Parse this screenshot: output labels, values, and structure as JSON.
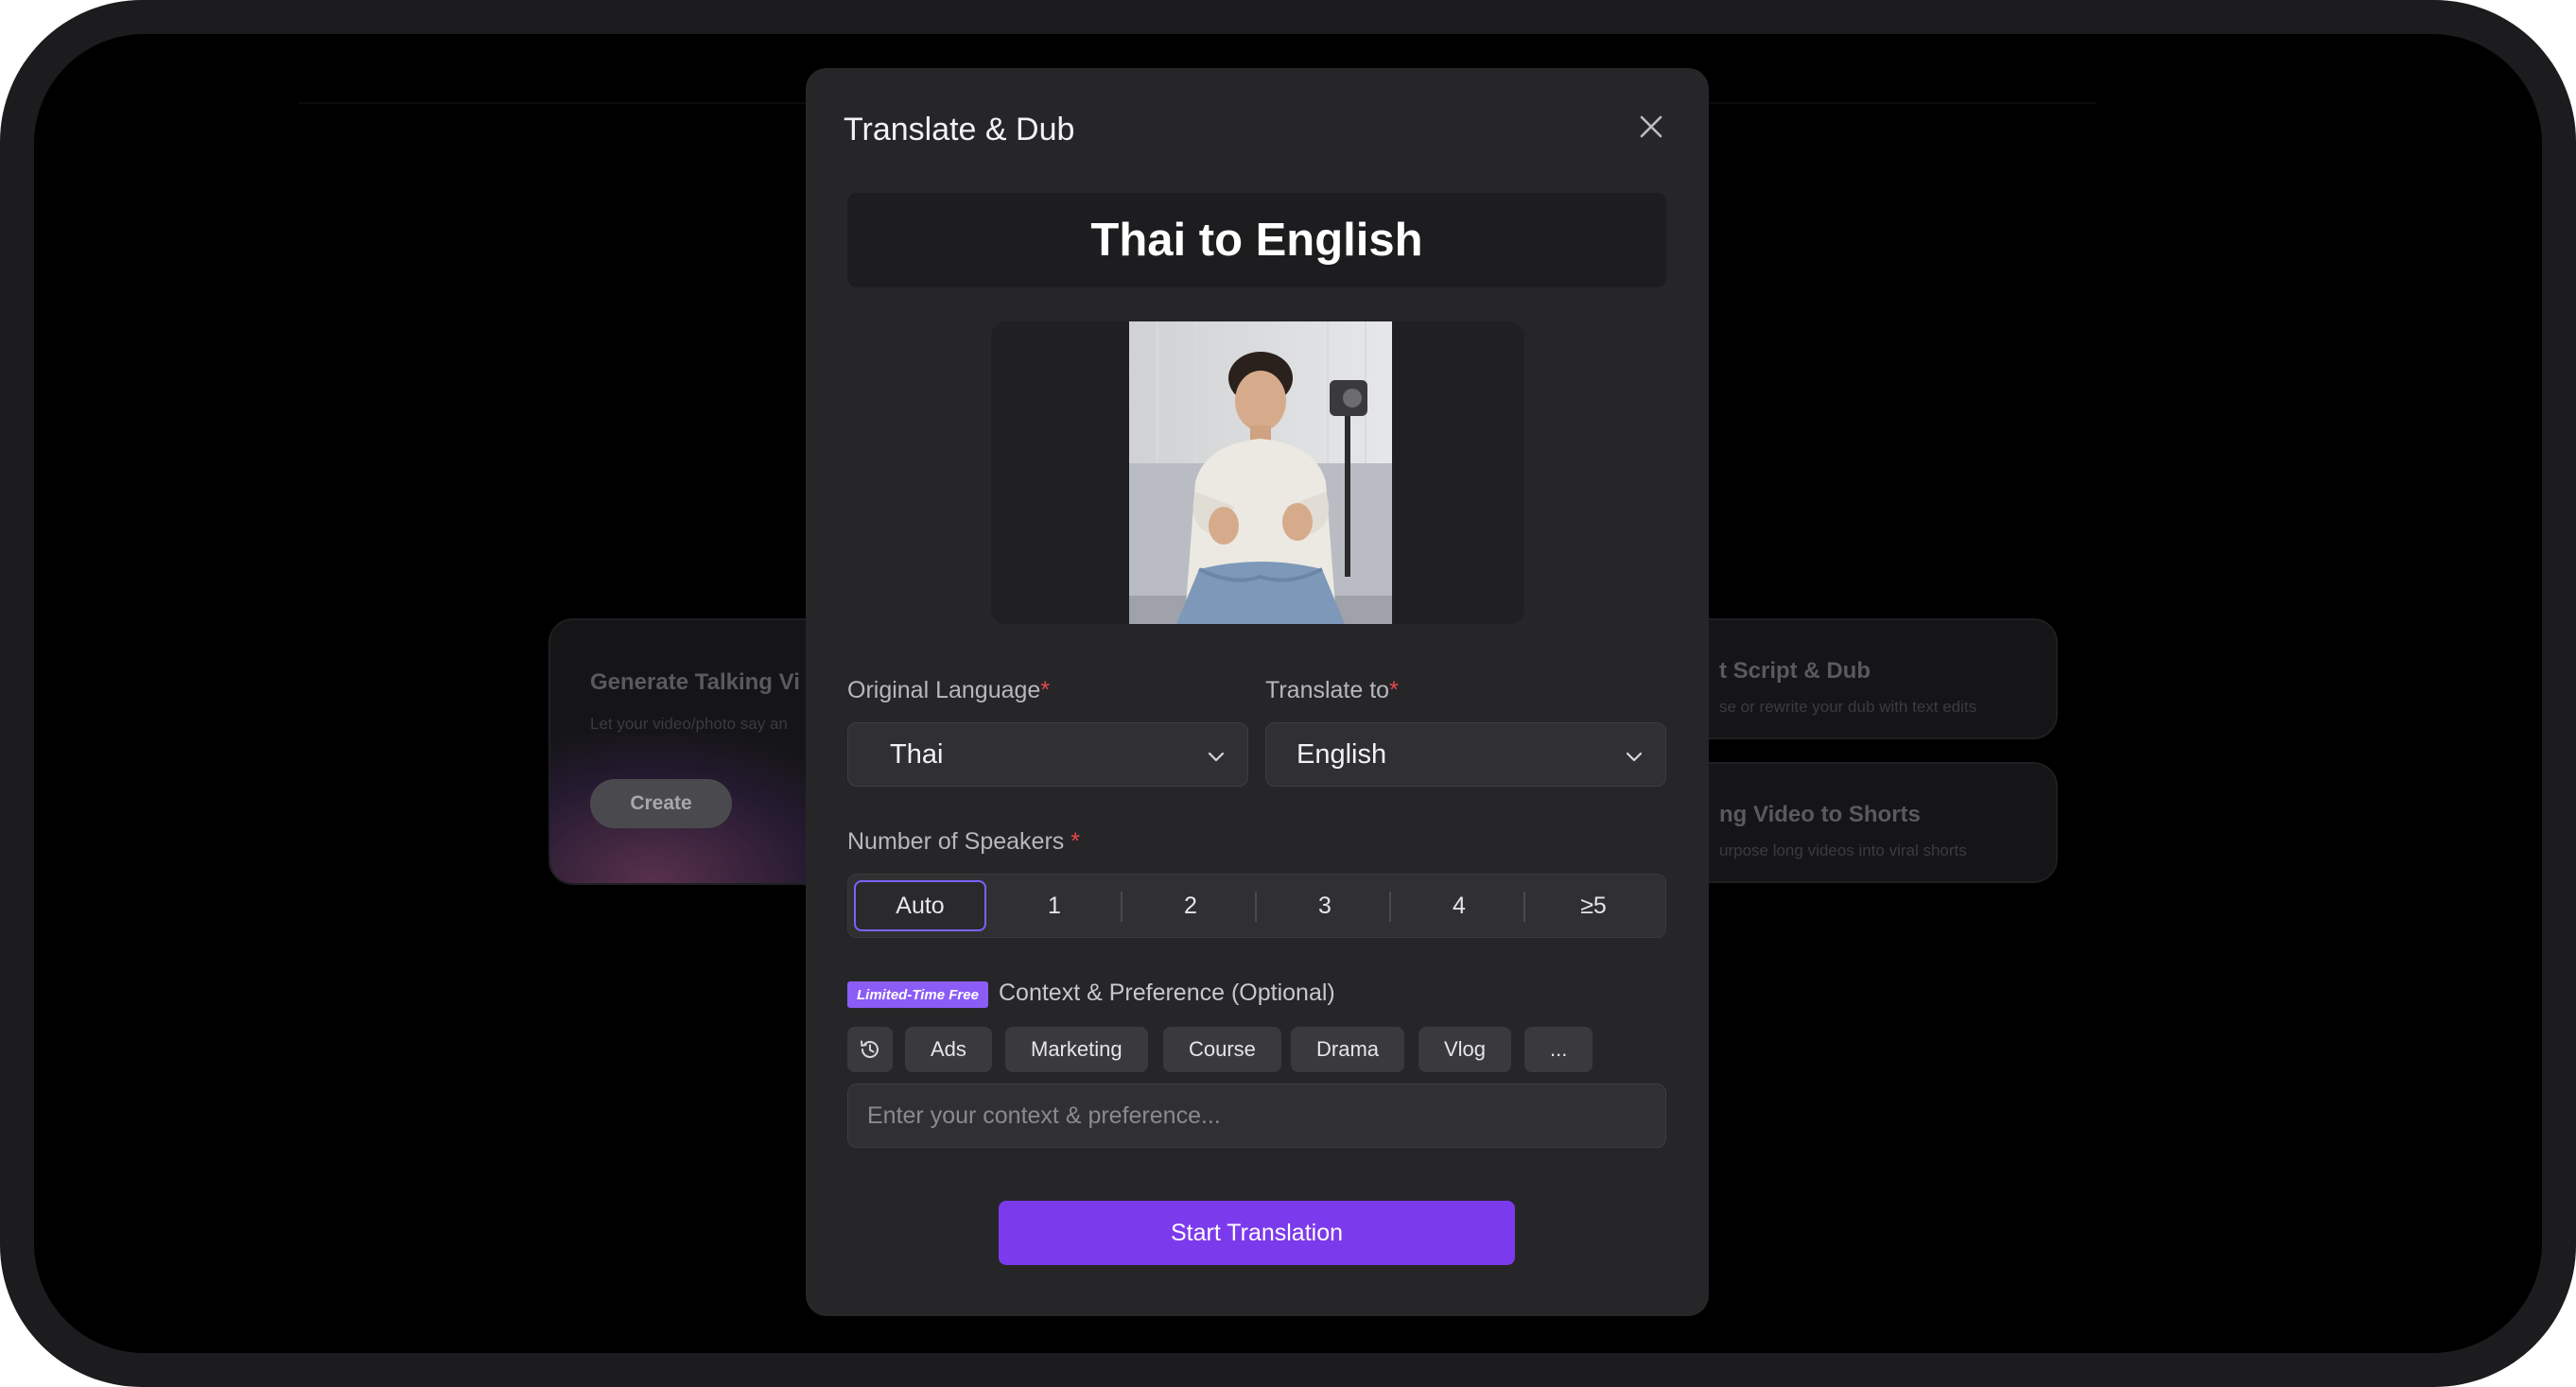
{
  "background": {
    "cards": {
      "talking": {
        "title": "Generate Talking Vi",
        "description": "Let your video/photo say an",
        "button_label": "Create"
      },
      "script": {
        "title": "t Script & Dub",
        "description": "se or rewrite your dub with text edits"
      },
      "shorts": {
        "title": "ng Video to Shorts",
        "description": "urpose long videos into viral shorts"
      }
    }
  },
  "modal": {
    "title": "Translate & Dub",
    "close_icon": "close-icon",
    "banner": "Thai to English",
    "original_language": {
      "label": "Original Language",
      "required_mark": "*",
      "value": "Thai"
    },
    "translate_to": {
      "label": "Translate to",
      "required_mark": "*",
      "value": "English"
    },
    "speakers": {
      "label": "Number of Speakers",
      "required_mark": "*",
      "options": [
        "Auto",
        "1",
        "2",
        "3",
        "4",
        "≥5"
      ],
      "selected": "Auto"
    },
    "context": {
      "badge": "Limited-Time Free",
      "label": "Context & Preference (Optional)",
      "history_icon": "history-icon",
      "chips": [
        "Ads",
        "Marketing",
        "Course",
        "Drama",
        "Vlog",
        "..."
      ],
      "placeholder": "Enter your context & preference...",
      "value": ""
    },
    "start_button": "Start Translation"
  },
  "colors": {
    "accent": "#7c3aed",
    "selected_border": "#7b61ff",
    "badge": "#8b5cf6",
    "required": "#e5484d"
  }
}
